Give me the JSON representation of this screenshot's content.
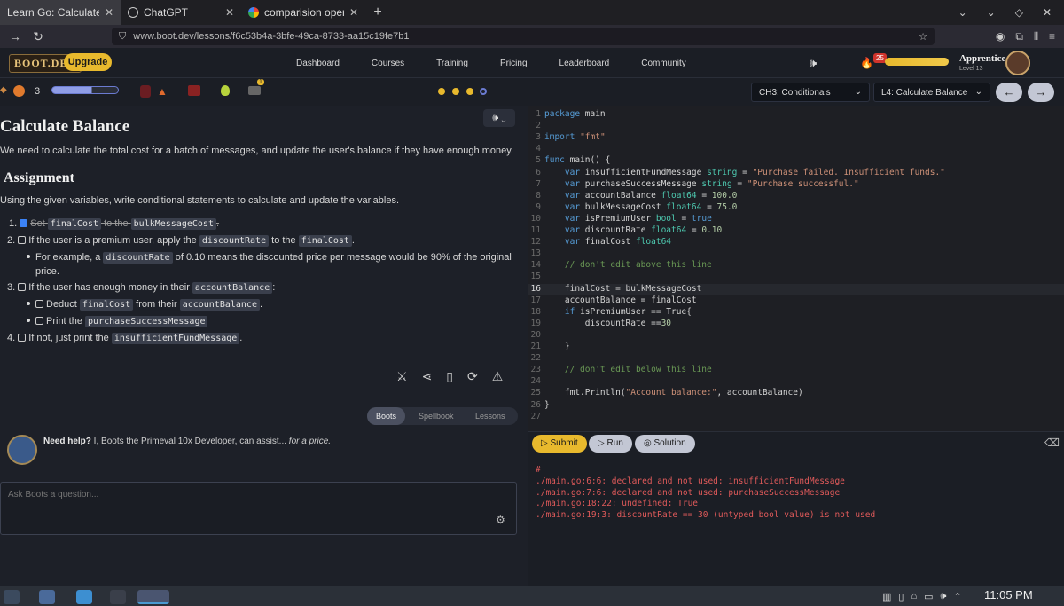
{
  "browser": {
    "tabs": [
      {
        "title": "Learn Go: Calculate Balanc",
        "active": true
      },
      {
        "title": "ChatGPT",
        "active": false
      },
      {
        "title": "comparision operator in g",
        "active": false
      }
    ],
    "new_tab": "+",
    "url": "www.boot.dev/lessons/f6c53b4a-3bfe-49ca-8733-aa15c19fe7b1"
  },
  "site": {
    "logo": "BOOT.DEV",
    "upgrade": "Upgrade",
    "nav": [
      "Dashboard",
      "Courses",
      "Training",
      "Pricing",
      "Leaderboard",
      "Community"
    ],
    "flame_count": "25",
    "username": "Apprentice",
    "level": "Level 13"
  },
  "toolbar": {
    "streak": "3",
    "progress": 0.6,
    "chapter": "CH3: Conditionals",
    "lesson": "L4: Calculate Balance",
    "badge": "1"
  },
  "lesson": {
    "title": "Calculate Balance",
    "intro": "We need to calculate the total cost for a batch of messages, and update the user's balance if they have enough money.",
    "assignment_heading": "Assignment",
    "assignment_desc": "Using the given variables, write conditional statements to calculate and update the variables.",
    "s1_num": "1.",
    "s1_a": "Set ",
    "s1_b": "finalCost",
    "s1_c": " to the ",
    "s1_d": "bulkMessageCost",
    "s1_e": ".",
    "s2_num": "2.",
    "s2_a": "If the user is a premium user, apply the ",
    "s2_b": "discountRate",
    "s2_c": " to the ",
    "s2_d": "finalCost",
    "s2_e": ".",
    "s2b_a": "For example, a ",
    "s2b_b": "discountRate",
    "s2b_c": " of 0.10 means the discounted price per message would be 90% of the original",
    "s2b_d": "price.",
    "s3_num": "3.",
    "s3_a": "If the user has enough money in their ",
    "s3_b": "accountBalance",
    "s3_c": ":",
    "s3a_a": "Deduct ",
    "s3a_b": "finalCost",
    "s3a_c": " from their ",
    "s3a_d": "accountBalance",
    "s3a_e": ".",
    "s3b_a": "Print the ",
    "s3b_b": "purchaseSuccessMessage",
    "s4_num": "4.",
    "s4_a": "If not, just print the ",
    "s4_b": "insufficientFundMessage",
    "s4_c": "."
  },
  "assistant": {
    "tabs": [
      "Boots",
      "Spellbook",
      "Lessons"
    ],
    "help_bold": "Need help?",
    "help_text": " I, Boots the Primeval 10x Developer, can assist... ",
    "help_italic": "for a price.",
    "placeholder": "Ask Boots a question..."
  },
  "code": {
    "lines": [
      "package main",
      "",
      "import \"fmt\"",
      "",
      "func main() {",
      "\tvar insufficientFundMessage string = \"Purchase failed. Insufficient funds.\"",
      "\tvar purchaseSuccessMessage string = \"Purchase successful.\"",
      "\tvar accountBalance float64 = 100.0",
      "\tvar bulkMessageCost float64 = 75.0",
      "\tvar isPremiumUser bool = true",
      "\tvar discountRate float64 = 0.10",
      "\tvar finalCost float64",
      "",
      "\t// don't edit above this line",
      "",
      "\tfinalCost = bulkMessageCost",
      "\taccountBalance = finalCost",
      "\tif isPremiumUser == True{",
      "\t\tdiscountRate ==30",
      "",
      "\t}",
      "",
      "\t// don't edit below this line",
      "",
      "\tfmt.Println(\"Account balance:\", accountBalance)",
      "}",
      ""
    ],
    "current_line": 16
  },
  "actions": {
    "submit": "Submit",
    "run": "Run",
    "solution": "Solution"
  },
  "console": {
    "lines": [
      "#",
      "./main.go:6:6: declared and not used: insufficientFundMessage",
      "./main.go:7:6: declared and not used: purchaseSuccessMessage",
      "./main.go:18:22: undefined: True",
      "./main.go:19:3: discountRate == 30 (untyped bool value) is not used"
    ]
  },
  "taskbar": {
    "clock": "11:05 PM"
  }
}
